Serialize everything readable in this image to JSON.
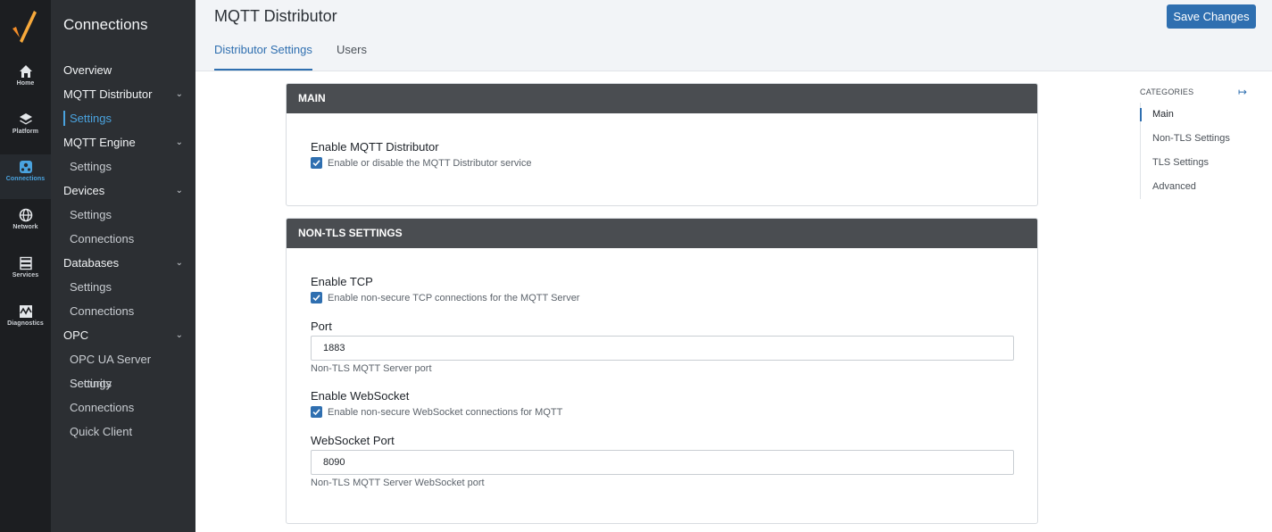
{
  "rail": {
    "items": [
      {
        "label": "Home",
        "icon": "home-icon"
      },
      {
        "label": "Platform",
        "icon": "layers-icon"
      },
      {
        "label": "Connections",
        "icon": "connections-icon"
      },
      {
        "label": "Network",
        "icon": "globe-icon"
      },
      {
        "label": "Services",
        "icon": "server-icon"
      },
      {
        "label": "Diagnostics",
        "icon": "pulse-icon"
      }
    ],
    "active": "Connections"
  },
  "sidebar": {
    "title": "Connections",
    "items": [
      {
        "label": "Overview"
      },
      {
        "label": "MQTT Distributor"
      },
      {
        "label": "Settings"
      },
      {
        "label": "MQTT Engine"
      },
      {
        "label": "Settings"
      },
      {
        "label": "Devices"
      },
      {
        "label": "Settings"
      },
      {
        "label": "Connections"
      },
      {
        "label": "Databases"
      },
      {
        "label": "Settings"
      },
      {
        "label": "Connections"
      },
      {
        "label": "OPC"
      },
      {
        "label": "OPC UA Server Settings"
      },
      {
        "label": "Security"
      },
      {
        "label": "Connections"
      },
      {
        "label": "Quick Client"
      }
    ]
  },
  "header": {
    "title": "MQTT Distributor",
    "save_label": "Save Changes",
    "tabs": [
      {
        "label": "Distributor Settings"
      },
      {
        "label": "Users"
      }
    ]
  },
  "main_section": {
    "title": "MAIN",
    "enable_label": "Enable MQTT Distributor",
    "enable_desc": "Enable or disable the MQTT Distributor service",
    "enable_checked": true
  },
  "nontls_section": {
    "title": "NON-TLS SETTINGS",
    "tcp_label": "Enable TCP",
    "tcp_desc": "Enable non-secure TCP connections for the MQTT Server",
    "tcp_checked": true,
    "port_label": "Port",
    "port_value": "1883",
    "port_hint": "Non-TLS MQTT Server port",
    "ws_label": "Enable WebSocket",
    "ws_desc": "Enable non-secure WebSocket connections for MQTT",
    "ws_checked": true,
    "wsport_label": "WebSocket Port",
    "wsport_value": "8090",
    "wsport_hint": "Non-TLS MQTT Server WebSocket port"
  },
  "categories": {
    "title": "CATEGORIES",
    "items": [
      {
        "label": "Main"
      },
      {
        "label": "Non-TLS Settings"
      },
      {
        "label": "TLS Settings"
      },
      {
        "label": "Advanced"
      }
    ]
  },
  "colors": {
    "accent": "#2f6fb0",
    "rail_bg": "#1c1e21",
    "sidebar_bg": "#2c2f33",
    "card_header_bg": "#4a4d51"
  }
}
